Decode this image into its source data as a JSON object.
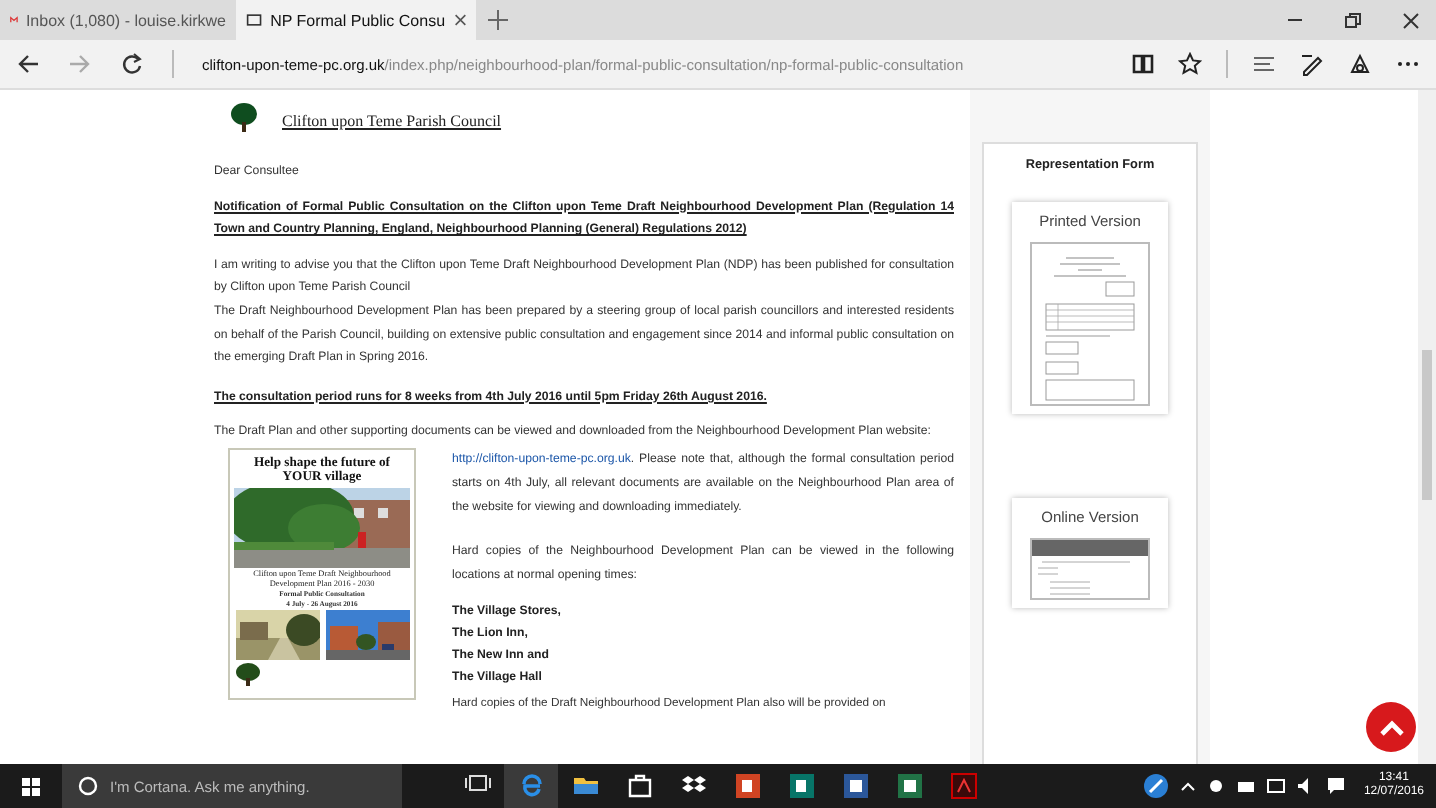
{
  "browser": {
    "tabs": [
      {
        "label": "Inbox (1,080) - louise.kirkwe",
        "kind": "mail",
        "selected": false
      },
      {
        "label": "NP Formal Public Consu",
        "kind": "page",
        "selected": true
      }
    ],
    "address": {
      "domain": "clifton-upon-teme-pc.org.uk",
      "path": "/index.php/neighbourhood-plan/formal-public-consultation/np-formal-public-consultation"
    }
  },
  "page": {
    "site_title": "Clifton upon Teme Parish Council",
    "greeting": "Dear Consultee",
    "notice_heading": "Notification of Formal Public Consultation on the Clifton upon Teme Draft Neighbourhood Development Plan (Regulation 14 Town and Country Planning, England, Neighbourhood Planning (General) Regulations 2012)",
    "intro": [
      "I am writing to advise you that the Clifton upon Teme Draft Neighbourhood Development Plan (NDP) has been published for consultation by Clifton upon Teme Parish Council",
      "The Draft Neighbourhood Development Plan has been prepared by a steering group of local parish councillors and interested residents on behalf of the Parish Council, building on extensive public consultation and engagement since 2014 and informal public consultation on the emerging Draft Plan in Spring 2016."
    ],
    "period": "The consultation period runs for 8 weeks from 4th July 2016 until 5pm Friday 26th August 2016.",
    "download_text": "The Draft Plan and other supporting documents can be viewed and downloaded from the Neighbourhood Development Plan website:",
    "website_link": "http://clifton-upon-teme-pc.org.uk",
    "website_note": ". Please note that, although the formal consultation period starts on 4th July, all relevant documents are available on the Neighbourhood Plan area of the website for viewing and downloading immediately.",
    "hard_copies": "Hard copies of the Neighbourhood Development Plan can be viewed in the following locations at normal opening times:",
    "locations": [
      "The Village Stores,",
      "The Lion Inn,",
      "The New Inn and",
      "The Village Hall"
    ],
    "more_copies": "Hard copies of the Draft Neighbourhood Development Plan also will be provided on",
    "poster": {
      "title": "Help shape the future of YOUR village",
      "plan_name": "Clifton upon Teme Draft Neighbourhood Development Plan 2016 - 2030",
      "subtitle": "Formal Public Consultation",
      "dates": "4 July - 26 August 2016"
    }
  },
  "sidebar": {
    "title": "Representation Form",
    "cards": [
      {
        "label": "Printed Version",
        "kind": "printed"
      },
      {
        "label": "Online Version",
        "kind": "online"
      }
    ]
  },
  "taskbar": {
    "search_placeholder": "I'm Cortana. Ask me anything.",
    "time": "13:41",
    "date": "12/07/2016"
  }
}
